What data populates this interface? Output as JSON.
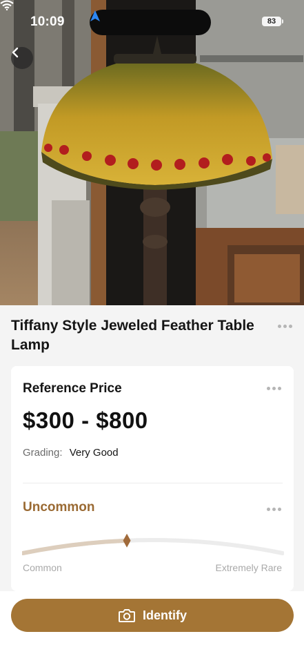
{
  "status_bar": {
    "time": "10:09",
    "battery": "83",
    "icons": [
      "location-arrow-icon",
      "wifi-icon",
      "battery-icon"
    ]
  },
  "header": {
    "back_icon": "chevron-left-icon"
  },
  "item": {
    "title": "Tiffany Style Jeweled Feather Table Lamp",
    "photo_subject": "stained-glass-lamp-photo"
  },
  "price_card": {
    "title": "Reference Price",
    "price": "$300 - $800",
    "grading_label": "Grading:",
    "grading_value": "Very Good"
  },
  "rarity": {
    "label": "Uncommon",
    "scale_min_label": "Common",
    "scale_max_label": "Extremely Rare",
    "level": 0.4
  },
  "bottom_bar": {
    "identify_label": "Identify",
    "identify_icon": "camera-icon"
  },
  "colors": {
    "accent": "#a47535",
    "rarity_text": "#9a6a33",
    "page_bg": "#f4f4f4",
    "card_bg": "#ffffff"
  }
}
